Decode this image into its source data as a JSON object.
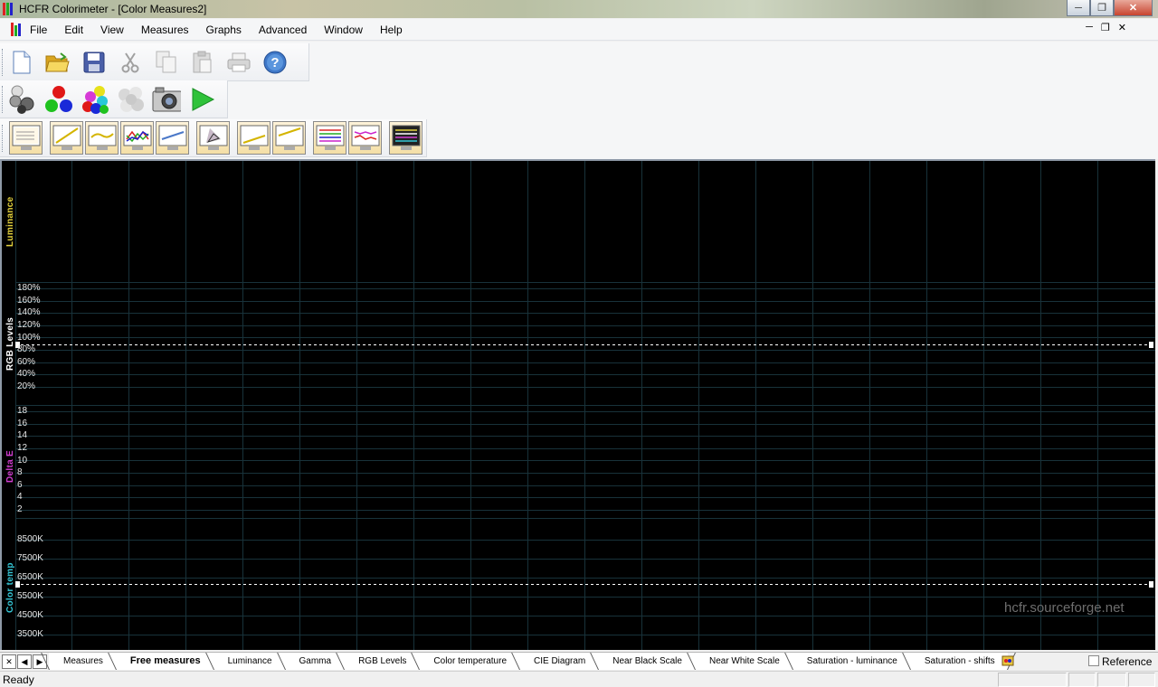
{
  "window": {
    "title": "HCFR Colorimeter - [Color Measures2]"
  },
  "menu": [
    "File",
    "Edit",
    "View",
    "Measures",
    "Graphs",
    "Advanced",
    "Window",
    "Help"
  ],
  "toolbar_file": [
    "new-icon",
    "open-folder-icon",
    "save-icon",
    "cut-icon",
    "copy-icon",
    "paste-icon",
    "print-icon",
    "help-icon"
  ],
  "toolbar_measure": [
    "gray-scale-measure-icon",
    "primary-colors-measure-icon",
    "secondary-colors-measure-icon",
    "saturation-measure-icon",
    "camera-icon",
    "play-icon"
  ],
  "toolbar_graphs": [
    "measures-view-icon",
    "luminance-graph-icon",
    "gamma-graph-icon",
    "rgb-levels-graph-icon",
    "color-temperature-graph-icon",
    "cie-diagram-icon",
    "near-black-graph-icon",
    "near-white-graph-icon",
    "saturation-luminance-graph-icon",
    "saturation-shifts-graph-icon",
    "free-measures-graph-icon"
  ],
  "graph": {
    "panel_labels": {
      "luminance": "Luminance",
      "rgb_levels": "RGB Levels",
      "delta_e": "Delta E",
      "color_temp": "Color temp"
    },
    "colors": {
      "luminance": "#e4d23c",
      "rgb_levels": "#ffffff",
      "delta_e": "#d23ed2",
      "color_temp": "#35c6d6",
      "grid": "#18323a",
      "background": "#000000"
    },
    "rgb_ticks": [
      "180%",
      "160%",
      "140%",
      "120%",
      "100%",
      "80%",
      "60%",
      "40%",
      "20%"
    ],
    "deltae_ticks": [
      "18",
      "16",
      "14",
      "12",
      "10",
      "8",
      "6",
      "4",
      "2"
    ],
    "colortemp_ticks": [
      "8500K",
      "7500K",
      "6500K",
      "5500K",
      "4500K",
      "3500K"
    ],
    "reference_lines": {
      "rgb_levels": "100%",
      "color_temp": "6500K"
    },
    "watermark": "hcfr.sourceforge.net"
  },
  "tabs": [
    "Measures",
    "Free measures",
    "Luminance",
    "Gamma",
    "RGB Levels",
    "Color temperature",
    "CIE Diagram",
    "Near Black Scale",
    "Near White Scale",
    "Saturation - luminance",
    "Saturation - shifts"
  ],
  "active_tab": "Free measures",
  "reference": {
    "label": "Reference",
    "checked": false
  },
  "status": {
    "text": "Ready"
  }
}
